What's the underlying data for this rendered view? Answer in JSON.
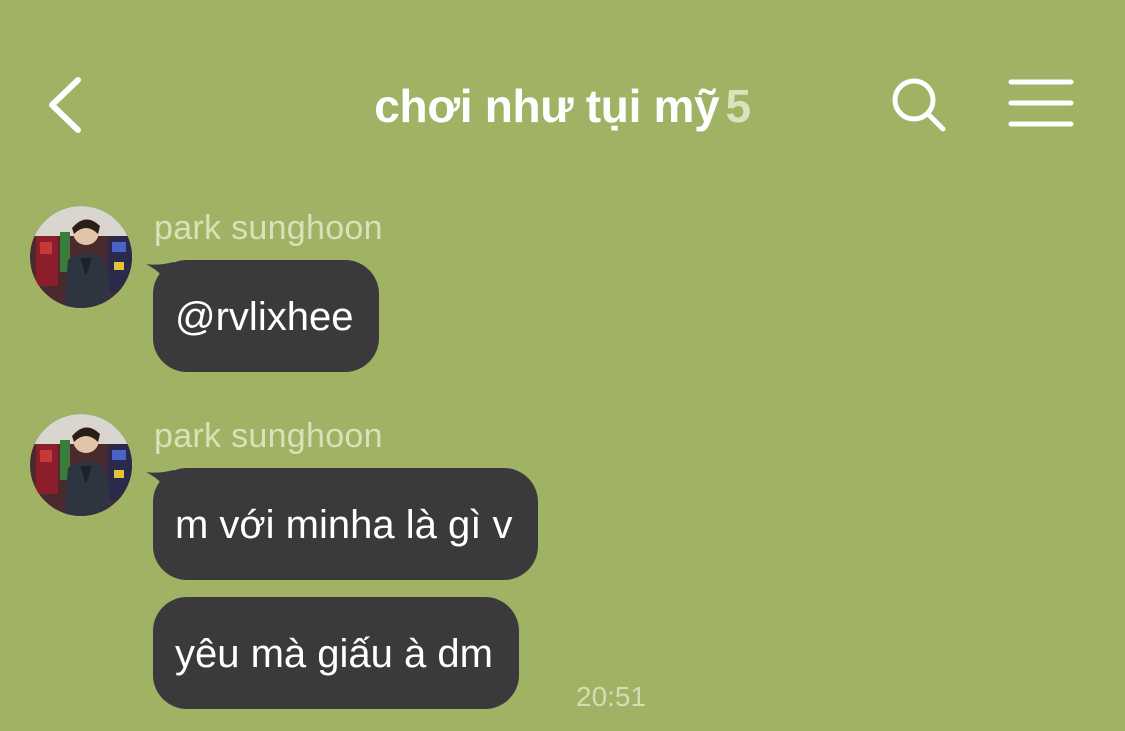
{
  "header": {
    "back_icon": "chevron-left-icon",
    "title": "chơi như tụi mỹ",
    "member_count": "5",
    "search_icon": "search-icon",
    "menu_icon": "hamburger-menu-icon"
  },
  "messages": [
    {
      "sender": "park sunghoon",
      "avatar_icon": "avatar",
      "bubbles": [
        {
          "text": "@rvlixhee"
        }
      ]
    },
    {
      "sender": "park sunghoon",
      "avatar_icon": "avatar",
      "bubbles": [
        {
          "text": "m với minha là gì v"
        },
        {
          "text": "yêu mà giấu à dm",
          "time": "20:51"
        }
      ]
    }
  ],
  "colors": {
    "background": "#a0b263",
    "bubble": "#3a3a3c",
    "header_text": "#ffffff",
    "sender_text": "#d8e2b8"
  }
}
